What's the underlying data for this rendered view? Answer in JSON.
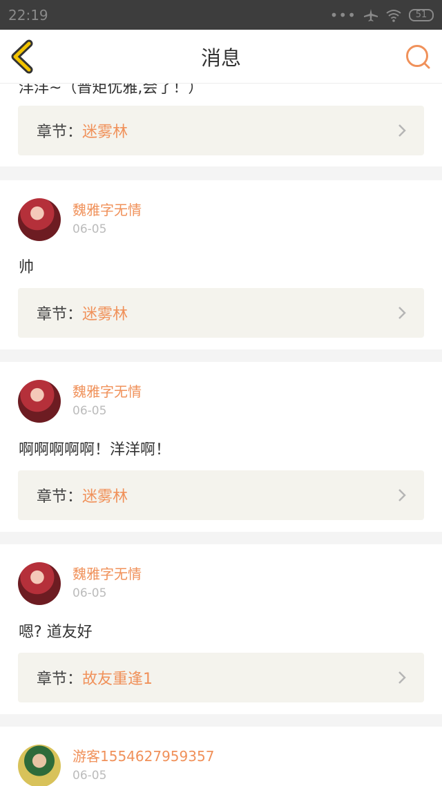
{
  "status_bar": {
    "time": "22:19",
    "dots": "•••",
    "battery": "51"
  },
  "header": {
    "title": "消息"
  },
  "chapter_prefix": "章节：",
  "partial_top": {
    "message": "洋洋~（晋矩优雅,会了！）",
    "chapter": "迷雾林"
  },
  "messages": [
    {
      "user": "魏雅字无情",
      "date": "06-05",
      "text": "帅",
      "chapter": "迷雾林"
    },
    {
      "user": "魏雅字无情",
      "date": "06-05",
      "text": "啊啊啊啊啊！洋洋啊！",
      "chapter": "迷雾林"
    },
    {
      "user": "魏雅字无情",
      "date": "06-05",
      "text": "嗯? 道友好",
      "chapter": "故友重逢1"
    },
    {
      "user": "游客1554627959357",
      "date": "06-05"
    }
  ],
  "colors": {
    "accent": "#f0915a",
    "back_icon": "#f2c300",
    "status_bar": "#3d3d3d",
    "chapter_bg": "#f4f3ed"
  }
}
